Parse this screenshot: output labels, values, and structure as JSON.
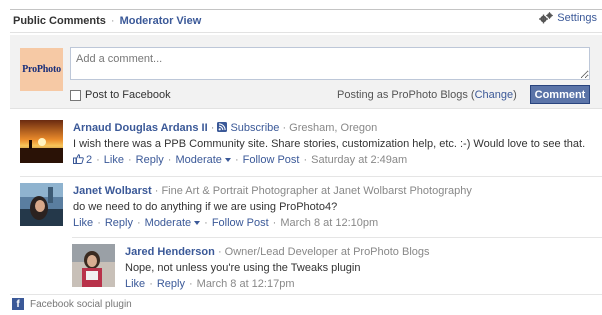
{
  "tabs": {
    "public": "Public Comments",
    "separator": "·",
    "moderator": "Moderator View"
  },
  "settings": {
    "label": "Settings",
    "icon": "gear-icon"
  },
  "compose": {
    "logo_text": "ProPhoto",
    "placeholder": "Add a comment...",
    "post_to_facebook": "Post to Facebook",
    "posting_as_prefix": "Posting as ProPhoto Blogs (",
    "change_label": "Change",
    "posting_as_suffix": ")",
    "comment_button": "Comment"
  },
  "comments": [
    {
      "name": "Arnaud Douglas Ardans II",
      "subscribe": "Subscribe",
      "location": "· Gresham, Oregon",
      "text": "I wish there was a PPB Community site. Share stories, customization help, etc. :-) Would love to see that.",
      "likes": "2",
      "actions": {
        "like": "Like",
        "reply": "Reply",
        "moderate": "Moderate",
        "follow": "Follow Post"
      },
      "timestamp": "Saturday at 2:49am"
    },
    {
      "name": "Janet Wolbarst",
      "tagline": "· Fine Art & Portrait Photographer at Janet Wolbarst Photography",
      "text": "do we need to do anything if we are using ProPhoto4?",
      "actions": {
        "like": "Like",
        "reply": "Reply",
        "moderate": "Moderate",
        "follow": "Follow Post"
      },
      "timestamp": "March 8 at 12:10pm"
    },
    {
      "name": "Jared Henderson",
      "tagline": "· Owner/Lead Developer at ProPhoto Blogs",
      "text": "Nope, not unless you're using the Tweaks plugin",
      "actions": {
        "like": "Like",
        "reply": "Reply"
      },
      "timestamp": "March 8 at 12:17pm"
    }
  ],
  "footer": {
    "label": "Facebook social plugin",
    "icon": "facebook-icon"
  },
  "colors": {
    "link": "#3b5998",
    "button": "#5b74a8",
    "compose_bg": "#f2f2f2",
    "logo_bg": "#f6c9a5"
  }
}
